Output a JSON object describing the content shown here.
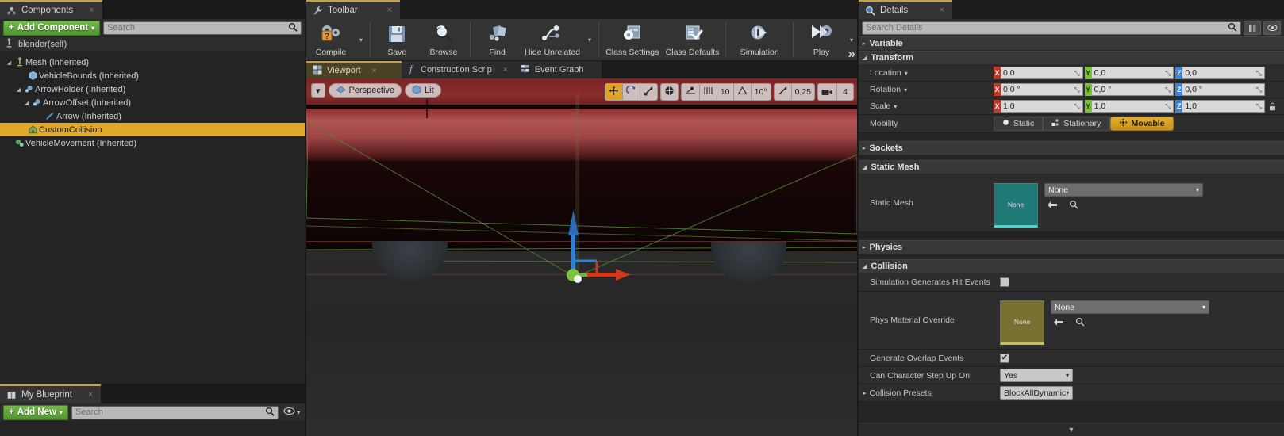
{
  "components_panel": {
    "tab": {
      "label": "Components",
      "icon": "components-icon",
      "close": "×"
    },
    "add_component_button": "Add Component",
    "add_component_caret": "▾",
    "search_placeholder": "Search",
    "search_icon": "search-icon",
    "self_row": "blender(self)",
    "tree": [
      {
        "label": "Mesh (Inherited)",
        "indent": 0,
        "twisty": "◢",
        "icon": "mesh-icon",
        "selected": false
      },
      {
        "label": "VehicleBounds (Inherited)",
        "indent": 1,
        "twisty": "",
        "icon": "box-icon",
        "selected": false
      },
      {
        "label": "ArrowHolder (Inherited)",
        "indent": 1,
        "twisty": "◢",
        "icon": "scene-icon",
        "selected": false
      },
      {
        "label": "ArrowOffset (Inherited)",
        "indent": 2,
        "twisty": "◢",
        "icon": "scene-icon",
        "selected": false
      },
      {
        "label": "Arrow (Inherited)",
        "indent": 3,
        "twisty": "",
        "icon": "arrow-icon",
        "selected": false
      },
      {
        "label": "CustomCollision",
        "indent": 1,
        "twisty": "",
        "icon": "collision-icon",
        "selected": true
      },
      {
        "label": "VehicleMovement (Inherited)",
        "indent": 0,
        "twisty": "",
        "icon": "movement-icon",
        "selected": false
      }
    ]
  },
  "my_blueprint_panel": {
    "tab": {
      "label": "My Blueprint",
      "icon": "blueprint-icon",
      "close": "×"
    },
    "add_new_button": "Add New",
    "add_new_caret": "▾",
    "search_placeholder": "Search",
    "eye_icon": "eye-icon",
    "eye_caret": "▾"
  },
  "toolbar_panel": {
    "tab": {
      "label": "Toolbar",
      "icon": "wrench-icon",
      "close": "×"
    },
    "items": [
      {
        "label": "Compile",
        "icon": "compile-icon",
        "caret": true
      },
      {
        "label": "Save",
        "icon": "save-icon",
        "caret": false
      },
      {
        "label": "Browse",
        "icon": "browse-icon",
        "caret": false
      },
      {
        "label": "Find",
        "icon": "find-icon",
        "caret": false
      },
      {
        "label": "Hide Unrelated",
        "icon": "hide-unrelated-icon",
        "caret": true
      },
      {
        "label": "Class Settings",
        "icon": "class-settings-icon",
        "caret": false
      },
      {
        "label": "Class Defaults",
        "icon": "class-defaults-icon",
        "caret": false
      },
      {
        "label": "Simulation",
        "icon": "simulation-icon",
        "caret": false
      },
      {
        "label": "Play",
        "icon": "play-icon",
        "caret": true
      }
    ],
    "overflow_chevron": "»"
  },
  "graph_tabs": [
    {
      "label": "Viewport",
      "icon": "viewport-icon",
      "active": true,
      "close": "×"
    },
    {
      "label": "Construction Scrip",
      "icon": "function-icon",
      "active": false,
      "close": "×"
    },
    {
      "label": "Event Graph",
      "icon": "event-graph-icon",
      "active": false,
      "close": ""
    }
  ],
  "viewport": {
    "menu_caret": "▾",
    "camera_mode": "Perspective",
    "camera_mode_icon": "camera-icon",
    "view_mode": "Lit",
    "view_mode_icon": "lit-icon",
    "transform_tools": [
      {
        "name": "translate-tool",
        "glyph": "✥",
        "active": true
      },
      {
        "name": "rotate-tool",
        "glyph": "↻",
        "active": false
      },
      {
        "name": "scale-tool",
        "glyph": "⤡",
        "active": false
      }
    ],
    "coord_space": {
      "name": "world-space-toggle",
      "glyph": "◑"
    },
    "surface_snap": {
      "name": "surface-snap-toggle",
      "glyph": "↗"
    },
    "grid_snap_toggle": {
      "name": "grid-snap-toggle",
      "glyph": "‖‖"
    },
    "grid_snap_value": "10",
    "rotation_snap_toggle": {
      "name": "rotation-snap-toggle",
      "glyph": "△"
    },
    "rotation_snap_value": "10°",
    "scale_snap_toggle": {
      "name": "scale-snap-toggle",
      "glyph": "↗"
    },
    "scale_snap_value": "0,25",
    "camera_speed_icon": "camera-speed-icon",
    "camera_speed_value": "4",
    "scene_description": "red car body viewed from below with green wireframe collision lines and a move gizmo"
  },
  "details_panel": {
    "tab": {
      "label": "Details",
      "icon": "details-icon",
      "close": "×"
    },
    "search_placeholder": "Search Details",
    "search_icon": "search-icon",
    "buttons": [
      {
        "name": "column-layout-button",
        "glyph": "‖"
      },
      {
        "name": "show-all-properties-button",
        "glyph": "◉"
      }
    ],
    "categories": [
      {
        "name": "variable",
        "label": "Variable",
        "expanded": false,
        "twisty": "▸"
      },
      {
        "name": "transform",
        "label": "Transform",
        "expanded": true,
        "twisty": "◢"
      },
      {
        "name": "sockets",
        "label": "Sockets",
        "expanded": false,
        "twisty": "▸"
      },
      {
        "name": "static-mesh",
        "label": "Static Mesh",
        "expanded": true,
        "twisty": "◢"
      },
      {
        "name": "physics",
        "label": "Physics",
        "expanded": false,
        "twisty": "▸"
      },
      {
        "name": "collision",
        "label": "Collision",
        "expanded": true,
        "twisty": "◢"
      }
    ],
    "transform": {
      "location": {
        "label": "Location",
        "caret": "▾",
        "x": "0,0",
        "y": "0,0",
        "z": "0,0"
      },
      "rotation": {
        "label": "Rotation",
        "caret": "▾",
        "x": "0,0 °",
        "y": "0,0 °",
        "z": "0,0 °"
      },
      "scale": {
        "label": "Scale",
        "caret": "▾",
        "x": "1,0",
        "y": "1,0",
        "z": "1,0",
        "lock_icon": "lock-icon"
      },
      "mobility": {
        "label": "Mobility",
        "options": [
          {
            "label": "Static",
            "icon": "static-icon",
            "active": false
          },
          {
            "label": "Stationary",
            "icon": "stationary-icon",
            "active": false
          },
          {
            "label": "Movable",
            "icon": "movable-icon",
            "active": true
          }
        ]
      },
      "axis_labels": {
        "x": "X",
        "y": "Y",
        "z": "Z"
      },
      "spinner_glyph": "⤡"
    },
    "static_mesh": {
      "label": "Static Mesh",
      "thumb_text": "None",
      "value": "None",
      "dropdown_caret": "▾",
      "back_icon": "use-selected-icon",
      "browse_icon": "browse-asset-icon"
    },
    "collision": {
      "simulation_hit_events": {
        "label": "Simulation Generates Hit Events",
        "checked": false,
        "check": ""
      },
      "phys_material_override": {
        "label": "Phys Material Override",
        "thumb_text": "None",
        "value": "None",
        "dropdown_caret": "▾",
        "back_icon": "use-selected-icon",
        "browse_icon": "browse-asset-icon"
      },
      "generate_overlap_events": {
        "label": "Generate Overlap Events",
        "checked": true,
        "check": "✔"
      },
      "can_character_step_up_on": {
        "label": "Can Character Step Up On",
        "value": "Yes",
        "caret": "▾"
      },
      "collision_presets": {
        "label": "Collision Presets",
        "value": "BlockAllDynamic",
        "caret": "▾",
        "twisty": "▸"
      }
    },
    "footer_caret": "▼"
  },
  "colors": {
    "accent_yellow": "#e0a92b",
    "green_button": "#5ea336",
    "axis_x": "#c0392b",
    "axis_y": "#79c23b",
    "axis_z": "#3a86d8",
    "panel_bg": "#242424",
    "tab_bg": "#343434"
  }
}
